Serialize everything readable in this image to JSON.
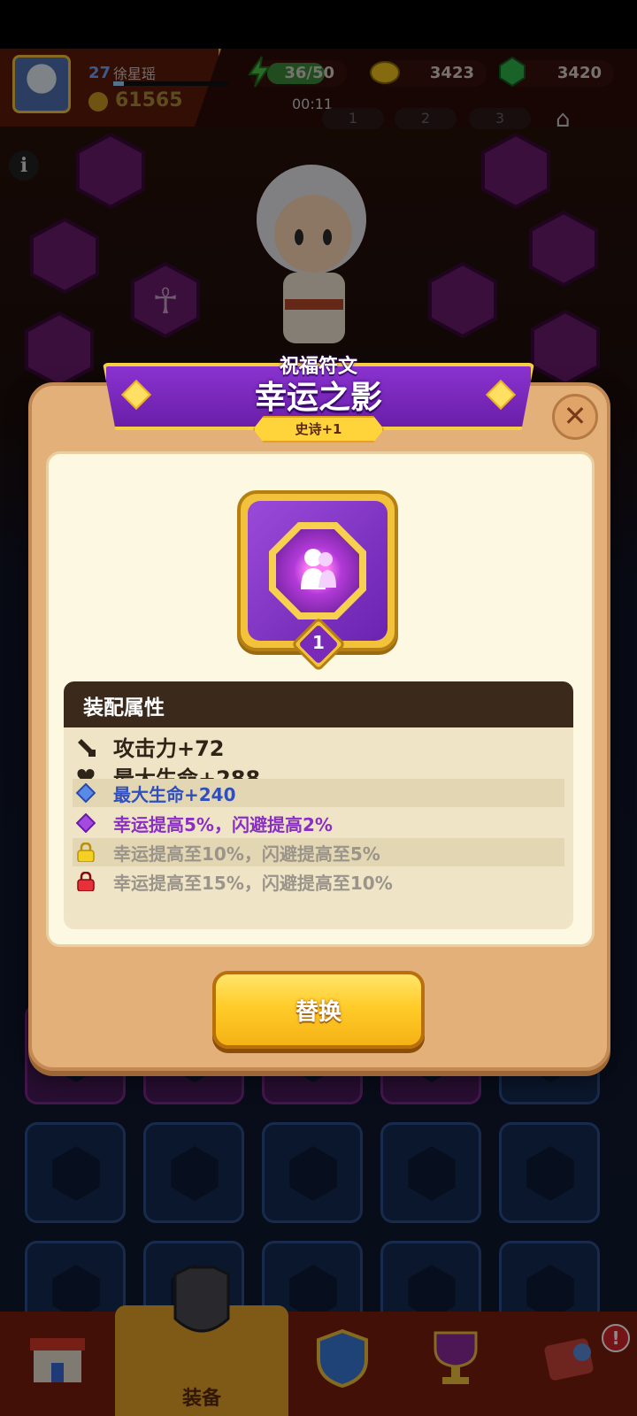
{
  "hud": {
    "level": "27",
    "player_name": "徐星瑶",
    "score": "61565",
    "energy": "36/50",
    "energy_fraction": 0.72,
    "gold": "3423",
    "gems": "3420",
    "timer": "00:11",
    "pages": [
      "1",
      "2",
      "3"
    ]
  },
  "popup": {
    "subtitle": "祝福符文",
    "title": "幸运之影",
    "rarity": "史诗+1",
    "rune_level": "1",
    "attributes_header": "装配属性",
    "attributes": [
      {
        "icon": "sword-icon",
        "text": "攻击力+72",
        "style": "base"
      },
      {
        "icon": "heart-icon",
        "text": "最大生命+288",
        "style": "base"
      },
      {
        "icon": "blue-gem-icon",
        "text": "最大生命+240",
        "style": "blue"
      },
      {
        "icon": "purple-gem-icon",
        "text": "幸运提高5%，闪避提高2%",
        "style": "purple"
      },
      {
        "icon": "yellow-lock-icon",
        "text": "幸运提高至10%，闪避提高至5%",
        "style": "grey"
      },
      {
        "icon": "red-lock-icon",
        "text": "幸运提高至15%，闪避提高至10%",
        "style": "grey"
      }
    ],
    "replace_label": "替换",
    "close_symbol": "✕"
  },
  "nav": {
    "selected_label": "装备",
    "badge": "!"
  },
  "colors": {
    "popup_bg": "#e3b07a",
    "banner_purple": "#7a28bc",
    "gold": "#f7cf43",
    "button_yellow": "#ffcc2a"
  }
}
